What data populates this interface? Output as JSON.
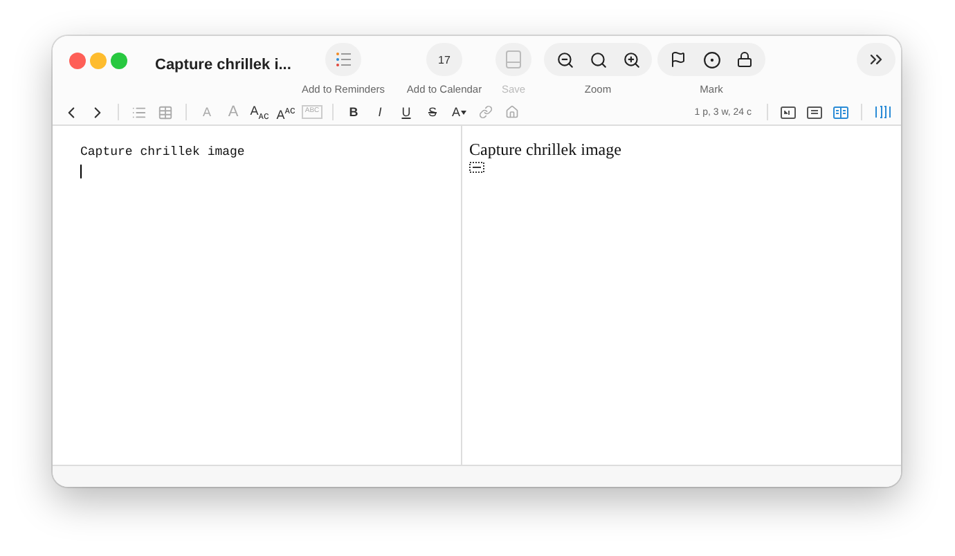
{
  "window": {
    "title": "Capture chrillek i..."
  },
  "toolbar": {
    "items": [
      {
        "kind": "reminders",
        "label": "Add to Reminders"
      },
      {
        "kind": "calendar",
        "label": "Add to Calendar",
        "day": "17"
      },
      {
        "kind": "save",
        "label": "Save",
        "disabled": true
      }
    ],
    "groups": [
      {
        "label": "Zoom",
        "buttons": [
          {
            "kind": "zoom-out"
          },
          {
            "kind": "zoom-actual"
          },
          {
            "kind": "zoom-in"
          }
        ]
      },
      {
        "label": "Mark",
        "buttons": [
          {
            "kind": "flag"
          },
          {
            "kind": "target"
          },
          {
            "kind": "lock"
          }
        ]
      }
    ]
  },
  "format_bar": {
    "style_buttons": [
      {
        "kind": "plain",
        "label": "A",
        "disabled": true
      },
      {
        "kind": "large",
        "label": "A",
        "disabled": true
      },
      {
        "kind": "plain",
        "label": "A$_{ᴀᴄ}$",
        "disabled": false
      },
      {
        "kind": "plain",
        "label": "A$^{ᴀᴄ}$",
        "disabled": false
      },
      {
        "kind": "tiny",
        "label": "ABC",
        "disabled": true
      }
    ],
    "text_buttons": [
      {
        "kind": "bold",
        "label": "B",
        "disabled": false
      },
      {
        "kind": "italic",
        "label": "I",
        "disabled": false
      },
      {
        "kind": "underline",
        "label": "U",
        "disabled": false
      },
      {
        "kind": "strike",
        "label": "S",
        "disabled": false
      },
      {
        "kind": "menu",
        "label": "A",
        "disabled": false
      }
    ],
    "status": "1 p, 3 w, 24 c",
    "view_modes": [
      {
        "selected": false
      },
      {
        "selected": false
      },
      {
        "selected": true
      }
    ],
    "inspector": {
      "active": true
    }
  },
  "editor": {
    "source_text": "Capture chrillek image",
    "preview_text": "Capture chrillek image"
  }
}
